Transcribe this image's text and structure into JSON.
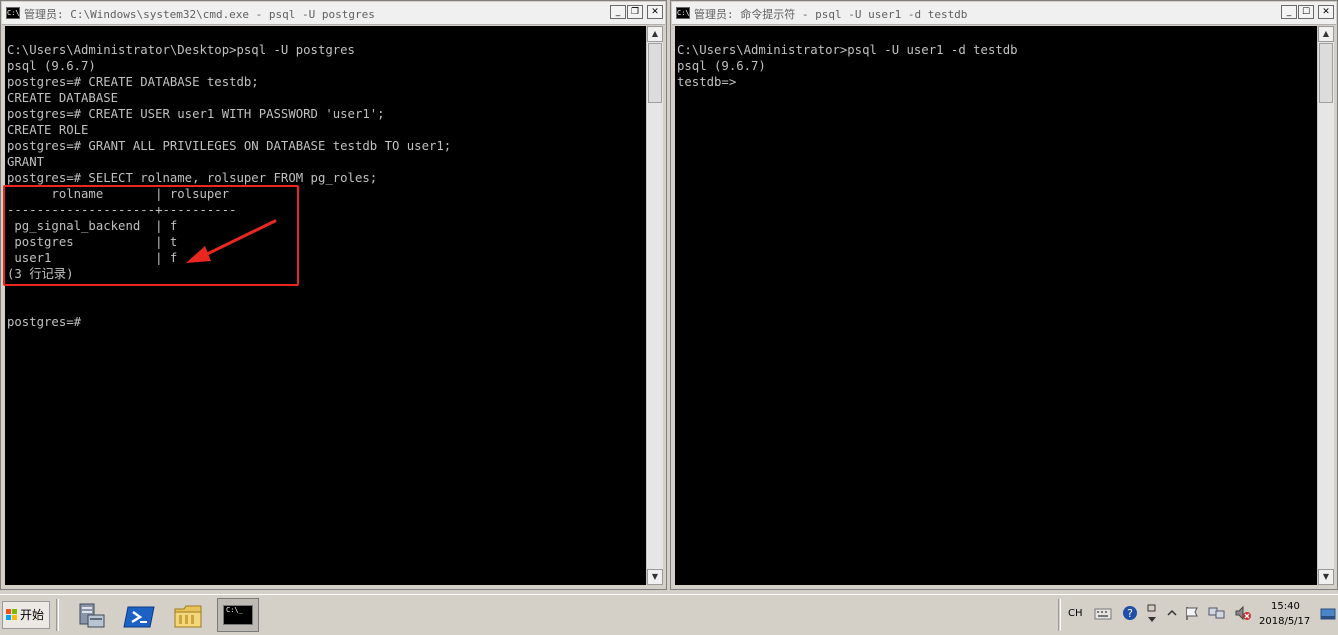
{
  "left_window": {
    "title": "管理员: C:\\Windows\\system32\\cmd.exe - psql  -U postgres",
    "icon": "cmd-icon",
    "minimize_label": "_",
    "maximize_label": "❐",
    "close_label": "✕",
    "lines": [
      "C:\\Users\\Administrator\\Desktop>psql -U postgres",
      "psql (9.6.7)",
      "postgres=# CREATE DATABASE testdb;",
      "CREATE DATABASE",
      "postgres=# CREATE USER user1 WITH PASSWORD 'user1';",
      "CREATE ROLE",
      "postgres=# GRANT ALL PRIVILEGES ON DATABASE testdb TO user1;",
      "GRANT",
      "postgres=# SELECT rolname, rolsuper FROM pg_roles;",
      "      rolname       | rolsuper",
      "--------------------+----------",
      " pg_signal_backend  | f",
      " postgres           | t",
      " user1              | f",
      "(3 行记录)",
      "",
      "",
      "postgres=#"
    ],
    "annotation_color": "#e8281e"
  },
  "right_window": {
    "title": "管理员: 命令提示符 - psql  -U user1 -d testdb",
    "icon": "cmd-icon",
    "minimize_label": "_",
    "maximize_label": "☐",
    "close_label": "✕",
    "lines": [
      "C:\\Users\\Administrator>psql -U user1 -d testdb",
      "psql (9.6.7)",
      "testdb=>"
    ]
  },
  "scrollbar": {
    "up_label": "▲",
    "down_label": "▼"
  },
  "taskbar": {
    "start_label": "开始",
    "cmd_task_label": "C:\\_",
    "icons": [
      "server-manager-icon",
      "powershell-icon",
      "explorer-folder-icon",
      "cmd-icon"
    ],
    "tray": {
      "language": "CH",
      "time": "15:40",
      "date": "2018/5/17"
    }
  }
}
